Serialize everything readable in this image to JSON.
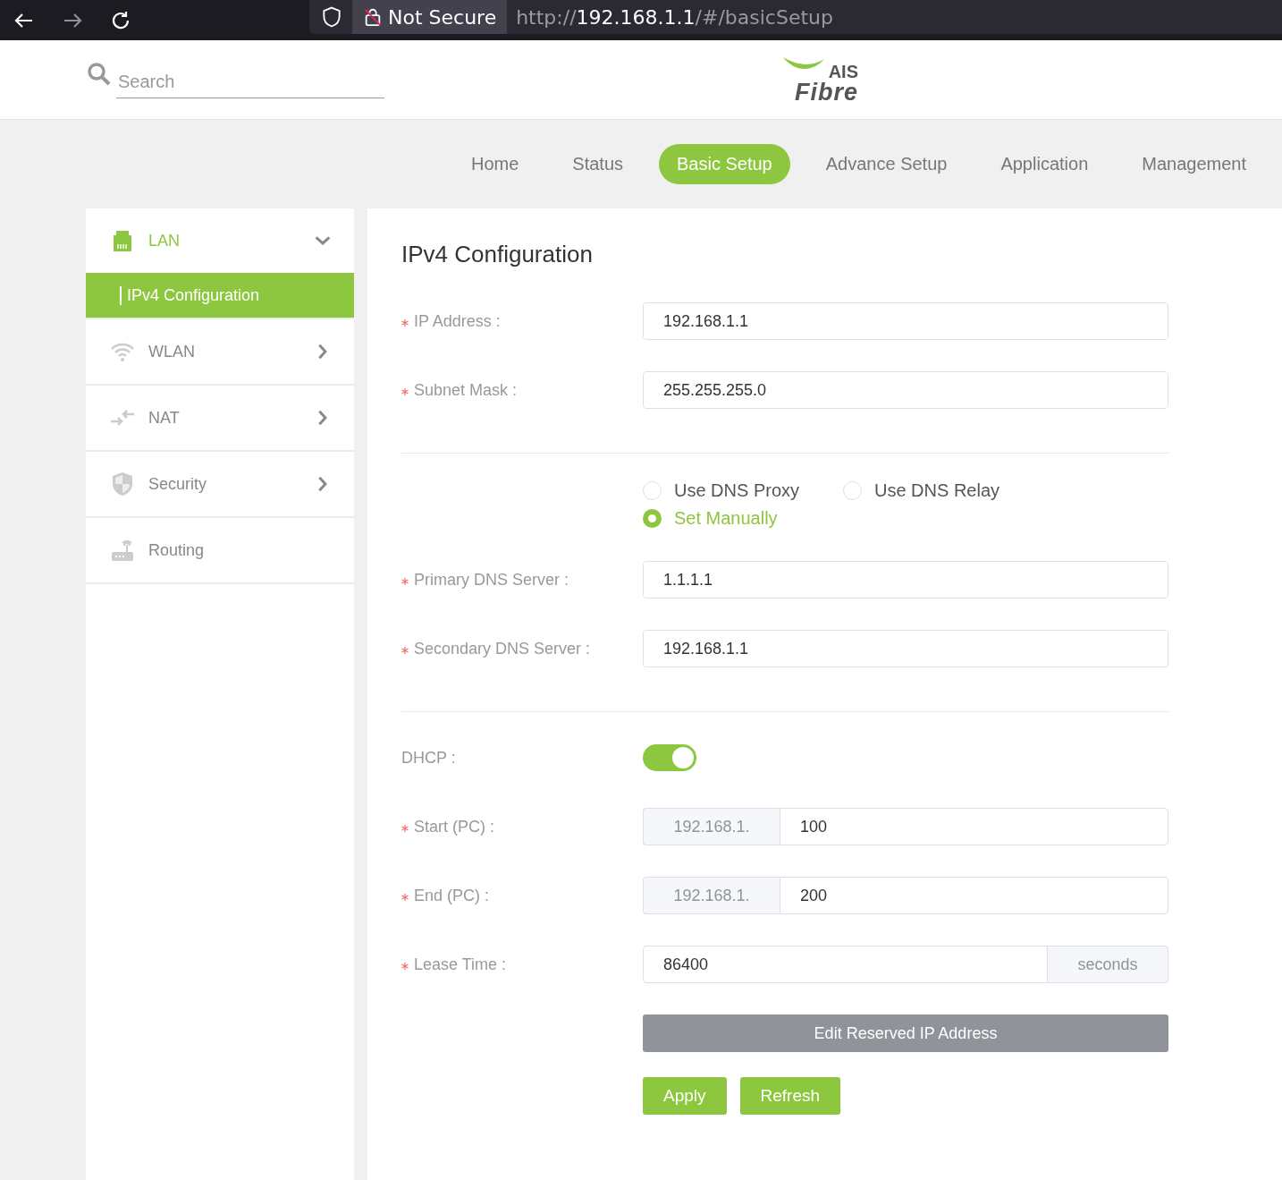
{
  "browser": {
    "security_label": "Not Secure",
    "url": {
      "scheme": "http://",
      "host": "192.168.1.1",
      "path": "/#/basicSetup"
    }
  },
  "header": {
    "search": {
      "placeholder": "Search"
    },
    "logo": {
      "top": "AIS",
      "bottom": "Fibre"
    }
  },
  "nav": [
    {
      "label": "Home",
      "selected": false
    },
    {
      "label": "Status",
      "selected": false
    },
    {
      "label": "Basic Setup",
      "selected": true
    },
    {
      "label": "Advance Setup",
      "selected": false
    },
    {
      "label": "Application",
      "selected": false
    },
    {
      "label": "Management",
      "selected": false
    }
  ],
  "sidebar": {
    "items": [
      {
        "kind": "lan",
        "label": "LAN",
        "expanded": true,
        "children": [
          {
            "label": "IPv4 Configuration",
            "selected": true
          }
        ]
      },
      {
        "kind": "wifi",
        "label": "WLAN",
        "expanded": false
      },
      {
        "kind": "nat",
        "label": "NAT",
        "expanded": false
      },
      {
        "kind": "shield",
        "label": "Security",
        "expanded": false
      },
      {
        "kind": "router",
        "label": "Routing"
      }
    ]
  },
  "main": {
    "title": "IPv4 Configuration",
    "sections": [
      {
        "rows": [
          {
            "kind": "text",
            "required": true,
            "label": "IP Address :",
            "value": "192.168.1.1"
          },
          {
            "kind": "text",
            "required": true,
            "label": "Subnet Mask :",
            "value": "255.255.255.0"
          }
        ]
      },
      {
        "dns_options": [
          {
            "label": "Use DNS Proxy",
            "selected": false
          },
          {
            "label": "Use DNS Relay",
            "selected": false
          },
          {
            "label": "Set Manually",
            "selected": true
          }
        ],
        "rows": [
          {
            "kind": "text",
            "required": true,
            "label": "Primary DNS Server :",
            "value": "1.1.1.1"
          },
          {
            "kind": "text",
            "required": true,
            "label": "Secondary DNS Server :",
            "value": "192.168.1.1"
          }
        ]
      },
      {
        "rows": [
          {
            "kind": "toggle",
            "required": false,
            "label": "DHCP :",
            "on": true
          },
          {
            "kind": "prefixed",
            "required": true,
            "label": "Start (PC) :",
            "prefix": "192.168.1.",
            "value": "100"
          },
          {
            "kind": "prefixed",
            "required": true,
            "label": "End (PC) :",
            "prefix": "192.168.1.",
            "value": "200"
          },
          {
            "kind": "suffixed",
            "required": true,
            "label": "Lease Time :",
            "value": "86400",
            "suffix": "seconds"
          }
        ]
      }
    ],
    "wide_button": "Edit Reserved IP Address",
    "buttons": [
      "Apply",
      "Refresh"
    ]
  }
}
